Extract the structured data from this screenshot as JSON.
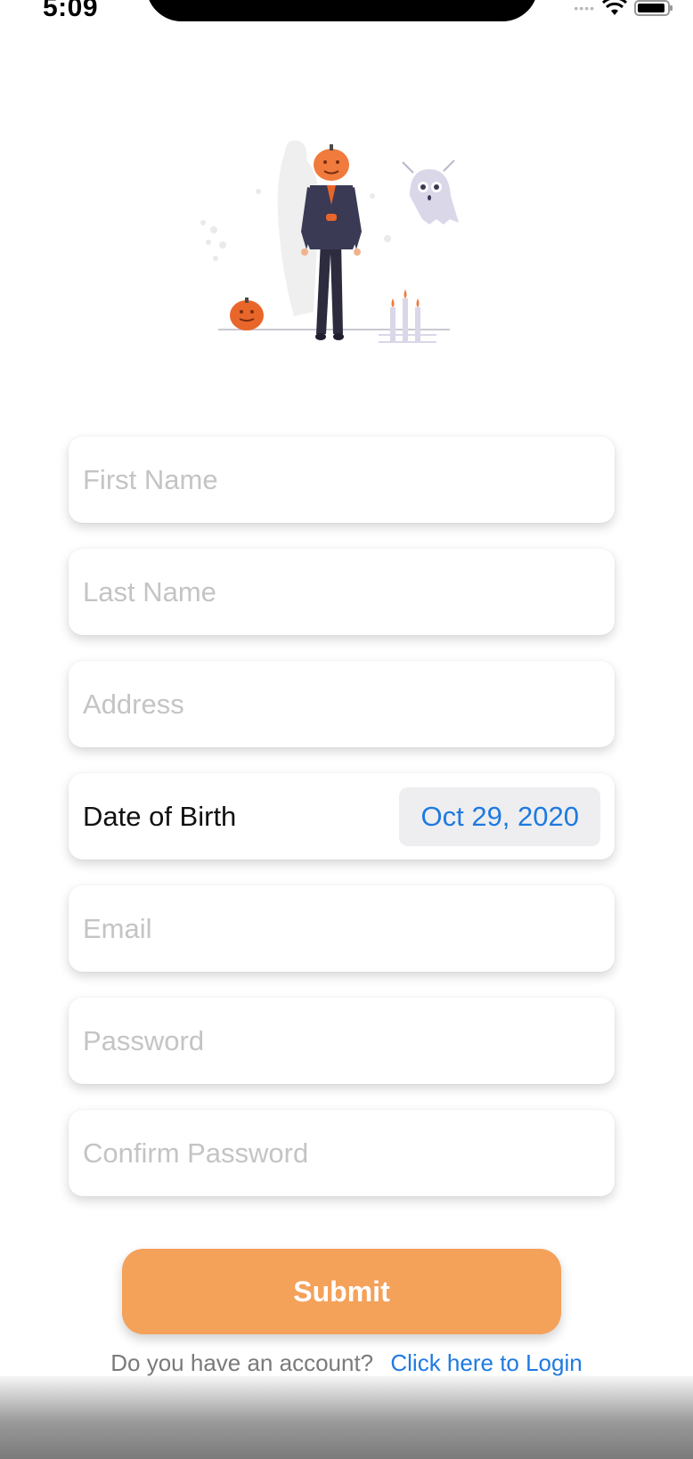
{
  "status_bar": {
    "time": "5:09"
  },
  "form": {
    "first_name_placeholder": "First Name",
    "last_name_placeholder": "Last Name",
    "address_placeholder": "Address",
    "dob_label": "Date of Birth",
    "dob_value": "Oct 29, 2020",
    "email_placeholder": "Email",
    "password_placeholder": "Password",
    "confirm_password_placeholder": "Confirm Password"
  },
  "submit_label": "Submit",
  "login": {
    "question": "Do you have an account?",
    "link": "Click here to Login"
  },
  "colors": {
    "accent": "#f4a15a",
    "link": "#1e7ae0",
    "pumpkin": "#e9662a"
  },
  "illustration": {
    "icon": "halloween-pumpkin-head-illustration"
  }
}
